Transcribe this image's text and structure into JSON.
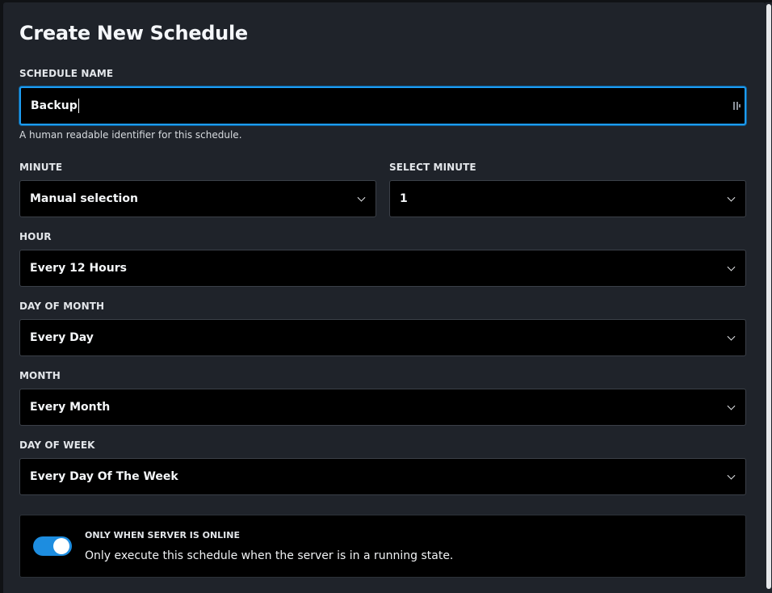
{
  "dialog": {
    "title": "Create New Schedule"
  },
  "schedule_name": {
    "label": "SCHEDULE NAME",
    "value": "Backup",
    "help": "A human readable identifier for this schedule."
  },
  "minute": {
    "label": "MINUTE",
    "value": "Manual selection"
  },
  "select_minute": {
    "label": "SELECT MINUTE",
    "value": "1"
  },
  "hour": {
    "label": "HOUR",
    "value": "Every 12 Hours"
  },
  "day_of_month": {
    "label": "DAY OF MONTH",
    "value": "Every Day"
  },
  "month": {
    "label": "MONTH",
    "value": "Every Month"
  },
  "day_of_week": {
    "label": "DAY OF WEEK",
    "value": "Every Day Of The Week"
  },
  "only_online": {
    "title": "ONLY WHEN SERVER IS ONLINE",
    "description": "Only execute this schedule when the server is in a running state.",
    "enabled": true
  },
  "colors": {
    "accent": "#1d9bf0",
    "background": "#1f232a",
    "field": "#000000"
  },
  "icons": {
    "select_chevron": "chevron-down-icon",
    "password_manager": "password-manager-icon"
  }
}
